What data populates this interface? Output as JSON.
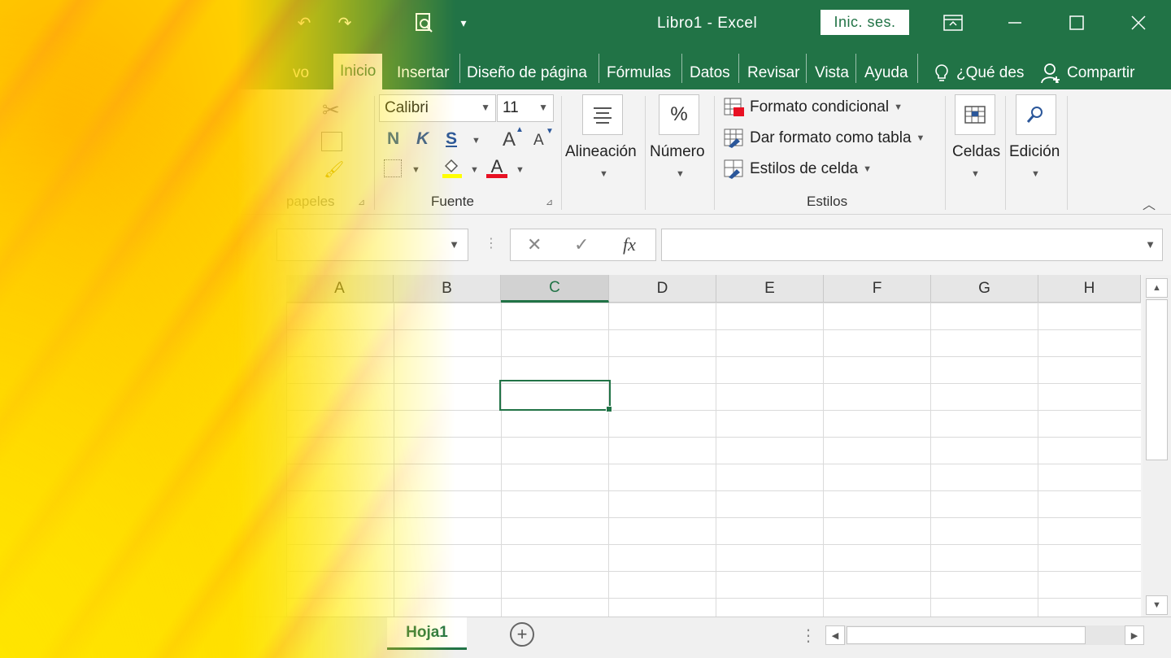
{
  "window": {
    "title": "Libro1  -  Excel",
    "signin_label": "Inic. ses."
  },
  "tabs": [
    {
      "label": "vo"
    },
    {
      "label": "Inicio"
    },
    {
      "label": "Insertar"
    },
    {
      "label": "Diseño de página"
    },
    {
      "label": "Fórmulas"
    },
    {
      "label": "Datos"
    },
    {
      "label": "Revisar"
    },
    {
      "label": "Vista"
    },
    {
      "label": "Ayuda"
    },
    {
      "label": "¿Qué des"
    },
    {
      "label": "Compartir"
    }
  ],
  "ribbon": {
    "clipboard_label": "papeles",
    "font": {
      "name": "Calibri",
      "size": "11",
      "bold": "N",
      "italic": "K",
      "underline": "S",
      "grow": "A",
      "shrink": "A",
      "fontcolor": "A",
      "label": "Fuente"
    },
    "alignment_label": "Alineación",
    "number_label": "Número",
    "number_icon": "%",
    "styles": {
      "conditional": "Formato condicional",
      "as_table": "Dar formato como tabla",
      "cell_styles": "Estilos de celda",
      "label": "Estilos"
    },
    "cells_label": "Celdas",
    "edit_label": "Edición"
  },
  "formula_bar": {
    "fx": "fx"
  },
  "grid": {
    "columns": [
      "A",
      "B",
      "C",
      "D",
      "E",
      "F",
      "G",
      "H"
    ],
    "selected_column": "C"
  },
  "sheets": [
    {
      "name": "Hoja1",
      "active": true
    }
  ],
  "colors": {
    "excel_green": "#217346",
    "overlay_yellow": "#ffd000",
    "overlay_orange": "#ff9800"
  }
}
